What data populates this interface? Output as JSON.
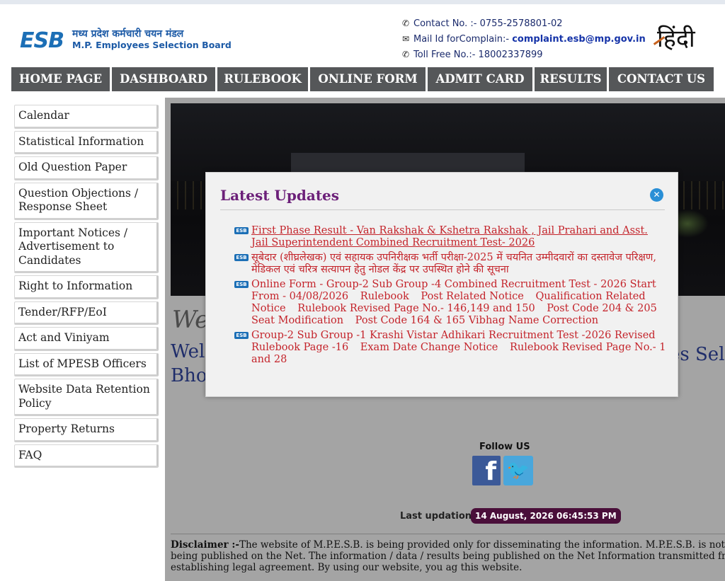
{
  "header": {
    "logo_text": "ESB",
    "board_name_hi": "मध्य प्रदेश कर्मचारी चयन मंडल",
    "board_name_en": "M.P. Employees Selection Board",
    "contact_label": "Contact No. :- 0755-2578801-02",
    "mail_label": "Mail Id forComplain:-",
    "mail_value": "complaint.esb@mp.gov.in",
    "tollfree_label": "Toll Free No.:- 18002337899",
    "language_link": "हिंदी"
  },
  "nav": {
    "items": [
      "HOME PAGE",
      "DASHBOARD",
      "RULEBOOK",
      "ONLINE FORM",
      "ADMIT CARD",
      "RESULTS",
      "CONTACT US"
    ]
  },
  "sidebar": {
    "items": [
      "Calendar",
      "Statistical Information",
      "Old Question Paper",
      "Question Objections / Response Sheet",
      "Important Notices / Advertisement to Candidates",
      "Right to Information",
      "Tender/RFP/EoI",
      "Act and Viniyam",
      "List of MPESB Officers",
      "Website Data Retention Policy",
      "Property Returns",
      "FAQ"
    ]
  },
  "main": {
    "welcome_script": "We",
    "welcome_line1": "Wel",
    "welcome_line2": "Bho",
    "welcome_right": "es Sel",
    "follow_us": "Follow US",
    "last_updation_label": "Last updation :",
    "last_updation_value": "14 August, 2026 06:45:53 PM",
    "disclaimer_label": "Disclaimer :-",
    "disclaimer_text": "The website of M.P.E.S.B. is being provided only for disseminating the information. M.P.E.S.B. is not respons crept in the information / results being published on the Net. The information / data / results being published on the Net Information transmitted from this website cannot be used for establishing legal agreement. By using our website, you ag this website."
  },
  "modal": {
    "title": "Latest Updates",
    "close_icon": "close-icon",
    "updates": [
      {
        "text": "First Phase Result - Van Rakshak & Kshetra Rakshak , Jail Prahari and Asst. Jail Superintendent Combined Recruitment Test- 2026",
        "links": []
      },
      {
        "text": "सूबेदार (शीघ्रलेखक) एवं सहायक उपनिरीक्षक भर्ती परीक्षा-2025 में चयनित उम्मीदवारों का दस्तावेज परिक्षण, मेडिकल एवं चरित्र सत्यापन हेतु नोडल केंद्र पर उपस्थित होने की सूचना",
        "links": []
      },
      {
        "text": "Online Form -  Group-2 Sub Group -4 Combined Recruitment Test - 2026 Start From - 04/08/2026",
        "links": [
          "Rulebook",
          "Post Related Notice",
          "Qualification Related Notice",
          "Rulebook Revised Page No.- 146,149 and 150",
          "Post Code 204 & 205 Seat Modification",
          "Post Code 164 & 165 Vibhag Name Correction"
        ]
      },
      {
        "text": "Group-2 Sub Group -1 Krashi Vistar Adhikari Recruitment Test -2026",
        "links": [
          "Revised Rulebook Page -16",
          "Exam Date Change Notice",
          "Rulebook Revised Page No.- 1 and 28"
        ]
      }
    ]
  },
  "colors": {
    "nav_bg": "#555759",
    "modal_title": "#6c2079",
    "update_text": "#c4242b",
    "brand_blue": "#1c6fb6",
    "badge_bg": "#4a0f3a"
  }
}
